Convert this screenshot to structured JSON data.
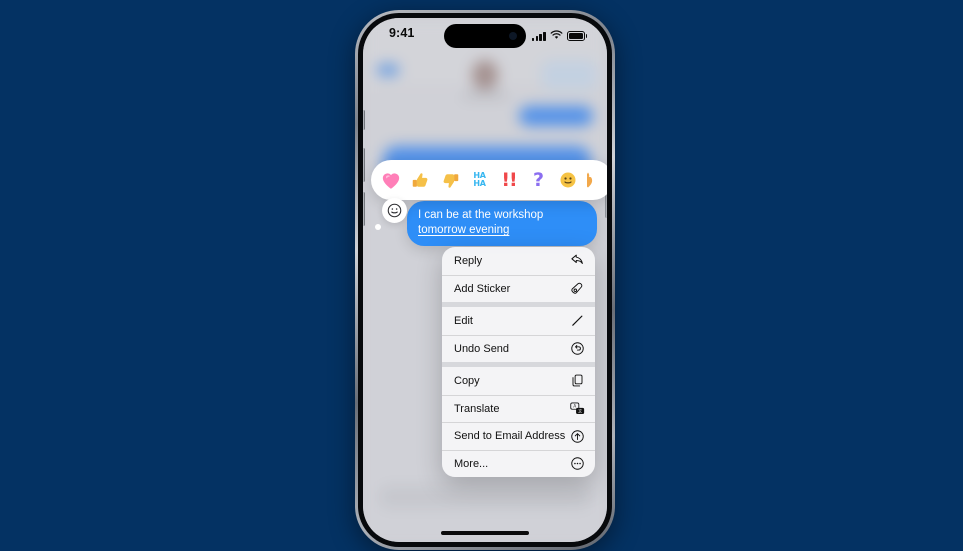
{
  "background": {
    "color": "#043263"
  },
  "device": {
    "name": "iphone-frame",
    "status_bar": {
      "time": "9:41",
      "icons": [
        "cellular-signal-icon",
        "wifi-icon",
        "battery-icon"
      ]
    },
    "home_indicator": "home-indicator"
  },
  "conversation_backdrop": {
    "description": "blurred messages conversation",
    "elements": [
      "back-chevron",
      "contact-avatar",
      "contact-name",
      "blue-message-bubble",
      "message-input-field"
    ]
  },
  "tapback_bar": {
    "name": "tapback-reaction-bar",
    "reactions": [
      {
        "id": "heart",
        "icon": "heart-emoji",
        "glyph": "🩷",
        "label": "Love"
      },
      {
        "id": "thumbs-up",
        "icon": "thumbs-up-emoji",
        "glyph": "👍",
        "label": "Like"
      },
      {
        "id": "thumbs-down",
        "icon": "thumbs-down-emoji",
        "glyph": "👎",
        "label": "Dislike"
      },
      {
        "id": "haha",
        "icon": "haha-text-icon",
        "glyph": "HA HA",
        "label": "Haha"
      },
      {
        "id": "exclamation",
        "icon": "double-exclamation-icon",
        "glyph": "!!",
        "label": "Emphasize"
      },
      {
        "id": "question",
        "icon": "question-mark-icon",
        "glyph": "?",
        "label": "Question"
      },
      {
        "id": "smiley",
        "icon": "smiley-face-emoji",
        "glyph": "🙂",
        "label": "Smiley"
      },
      {
        "id": "more",
        "icon": "partial-emoji-icon",
        "glyph": "🔥",
        "label": "More"
      }
    ],
    "tail_button": {
      "name": "add-tapback-smiley-button",
      "icon": "smiley-face-icon"
    }
  },
  "focused_message": {
    "name": "focused-message-bubble",
    "sender": "outgoing",
    "text_before": "I can be at the workshop ",
    "text_link": "tomorrow evening",
    "bubble_color": "#2e8ef7",
    "text_color": "#ffffff"
  },
  "context_menu": {
    "name": "message-context-menu",
    "groups": [
      {
        "items": [
          {
            "label": "Reply",
            "icon": "reply-arrow-icon"
          },
          {
            "label": "Add Sticker",
            "icon": "sticker-icon"
          }
        ]
      },
      {
        "items": [
          {
            "label": "Edit",
            "icon": "pencil-icon"
          },
          {
            "label": "Undo Send",
            "icon": "undo-circle-icon"
          }
        ]
      },
      {
        "items": [
          {
            "label": "Copy",
            "icon": "copy-icon"
          },
          {
            "label": "Translate",
            "icon": "translate-icon"
          },
          {
            "label": "Send to Email Address",
            "icon": "arrow-up-circle-icon"
          },
          {
            "label": "More...",
            "icon": "ellipsis-circle-icon"
          }
        ]
      }
    ]
  }
}
